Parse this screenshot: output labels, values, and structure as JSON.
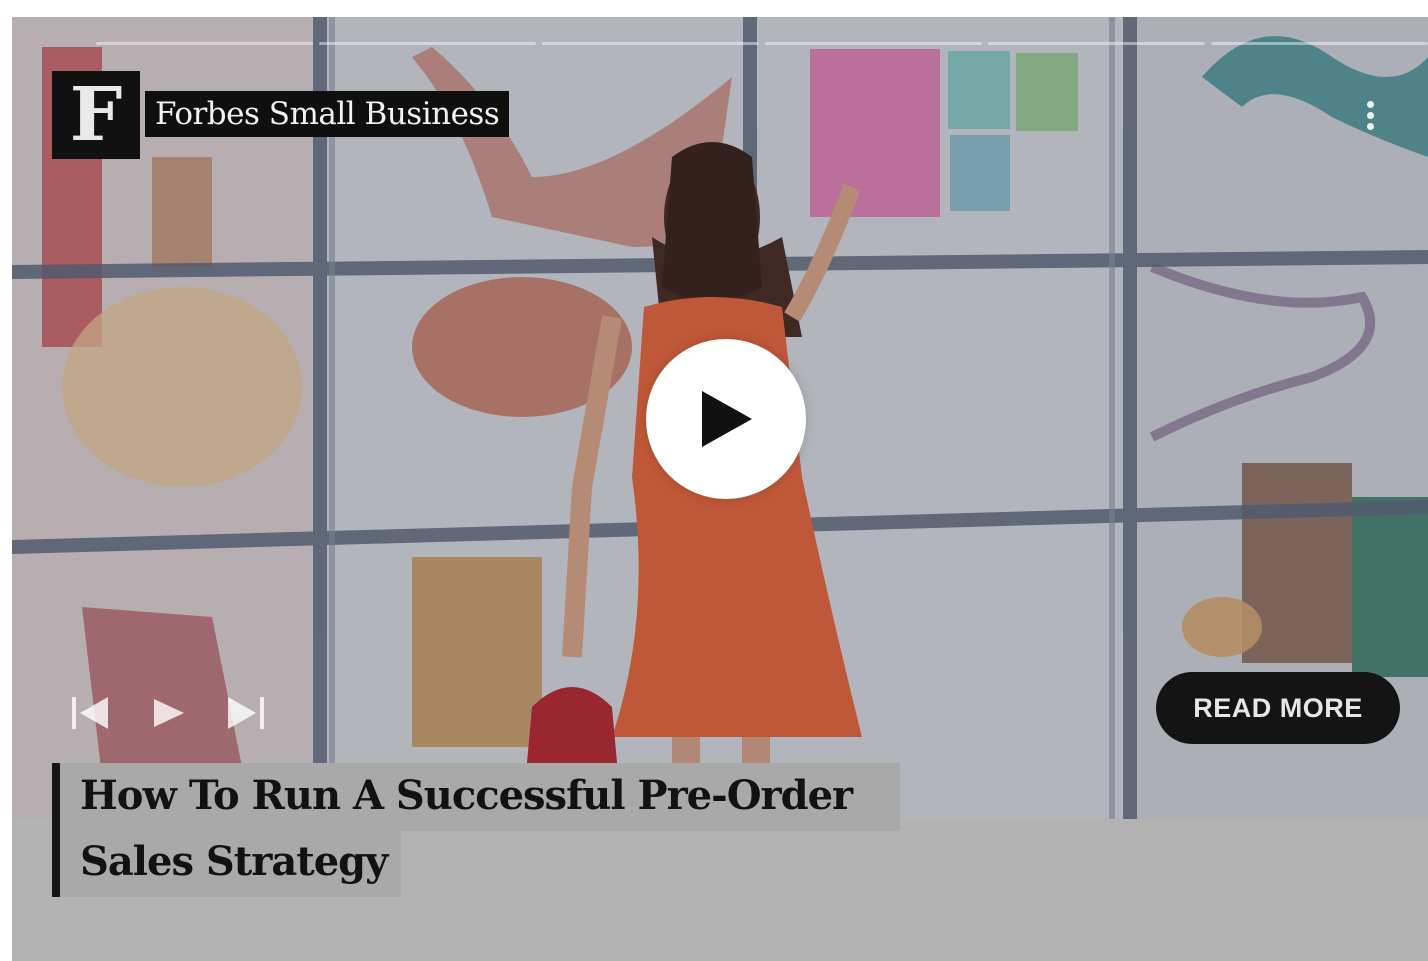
{
  "brand": {
    "logo_letter": "F",
    "name": "Forbes Small Business"
  },
  "video": {
    "headline_line1": "How To Run A Successful Pre-Order",
    "headline_line2": "Sales Strategy",
    "read_more_label": "READ MORE",
    "segment_count": 6
  },
  "icons": {
    "play": "play-icon",
    "previous": "skip-previous-icon",
    "small_play": "play-small-icon",
    "next": "skip-next-icon",
    "menu": "more-vertical-icon"
  },
  "colors": {
    "overlay_dark": "#111111",
    "headline_bg": "#a9a9a9",
    "page_bg": "#b3b3b3",
    "dress": "#e5673f"
  }
}
